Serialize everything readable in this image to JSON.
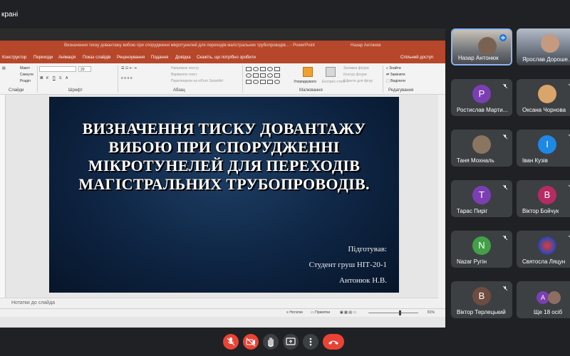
{
  "meet": {
    "title": "кранi"
  },
  "ppt": {
    "doc_title": "Визначення тиску довантажу вибою при спорудженні мікротунелей для переходів магістральних трубопроводів...  -  PowerPoint",
    "author": "Назар Антонюк",
    "tabs": [
      "Конструктор",
      "Переходи",
      "Анімація",
      "Показ слайдів",
      "Рецензування",
      "Подання",
      "Довідка",
      "Скажіть, що потрібно зробити",
      "Спільний доступ"
    ],
    "ribbon": {
      "slides_group": "Слайди",
      "font_group": "Шрифт",
      "paragraph_group": "Абзац",
      "drawing_group": "Малювання",
      "editing_group": "Редагування",
      "layout": "Макет",
      "reset": "Скинути",
      "section": "Розділ",
      "text_direction": "Напрямок тексту",
      "align_text": "Вирівняти текст",
      "smartart": "Перетворити на об'єкт SmartArt",
      "arrange": "Упорядкувати",
      "quick_styles": "Експрес-стилі",
      "shape_fill": "Заливка фігури",
      "shape_outline": "Контур фігури",
      "shape_effects": "Ефекти для фігур",
      "find": "Знайти",
      "replace": "Замінити",
      "select": "Виділити",
      "font_size": "20"
    },
    "slide": {
      "title_lines": [
        "ВИЗНАЧЕННЯ ТИСКУ ДОВАНТАЖУ",
        "ВИБОЮ ПРИ СПОРУДЖЕННІ",
        "МІКРОТУНЕЛЕЙ ДЛЯ ПЕРЕХОДІВ",
        "МАГІСТРАЛЬНИХ ТРУБОПРОВОДІВ."
      ],
      "prepared_by": "Підготував:",
      "student": "Студент груш НІТ-20-1",
      "name": "Антонюк Н.В."
    },
    "notes_placeholder": "Нотатки до слайда",
    "status": {
      "notes": "Нотатки",
      "comments": "Примітки",
      "zoom": "81%"
    }
  },
  "participants": [
    {
      "name": "Назар Антонюк",
      "avatar": "",
      "color": ""
    },
    {
      "name": "Ярослав Дороше...",
      "avatar": "",
      "color": ""
    },
    {
      "name": "Ростислав Марти...",
      "avatar": "Р",
      "color": "#7b3fb3"
    },
    {
      "name": "Оксана Чорнова",
      "avatar": "",
      "color": ""
    },
    {
      "name": "Таня Мохналь",
      "avatar": "",
      "color": ""
    },
    {
      "name": "Іван Кузів",
      "avatar": "I",
      "color": "#1e88e5"
    },
    {
      "name": "Тарас Пиріг",
      "avatar": "T",
      "color": "#7b3fb3"
    },
    {
      "name": "Віктор Бойчук",
      "avatar": "B",
      "color": "#b52b63"
    },
    {
      "name": "Nazar Pугін",
      "avatar": "N",
      "color": "#43a047"
    },
    {
      "name": "Святосла Ляцун",
      "avatar": "",
      "color": ""
    },
    {
      "name": "Віктор Терлецький",
      "avatar": "B",
      "color": "#6d4c41"
    },
    {
      "name": "Ще 18 осіб",
      "avatar": "A",
      "color": "#7b3fb3"
    }
  ],
  "colors": {
    "ppt_red": "#b7472a",
    "meet_bg": "#202124",
    "tile_bg": "#3c4043",
    "end_call": "#ea4335"
  },
  "icons": [
    "mic-off-icon",
    "camera-off-icon",
    "raise-hand-icon",
    "present-icon",
    "more-icon",
    "end-call-icon"
  ]
}
